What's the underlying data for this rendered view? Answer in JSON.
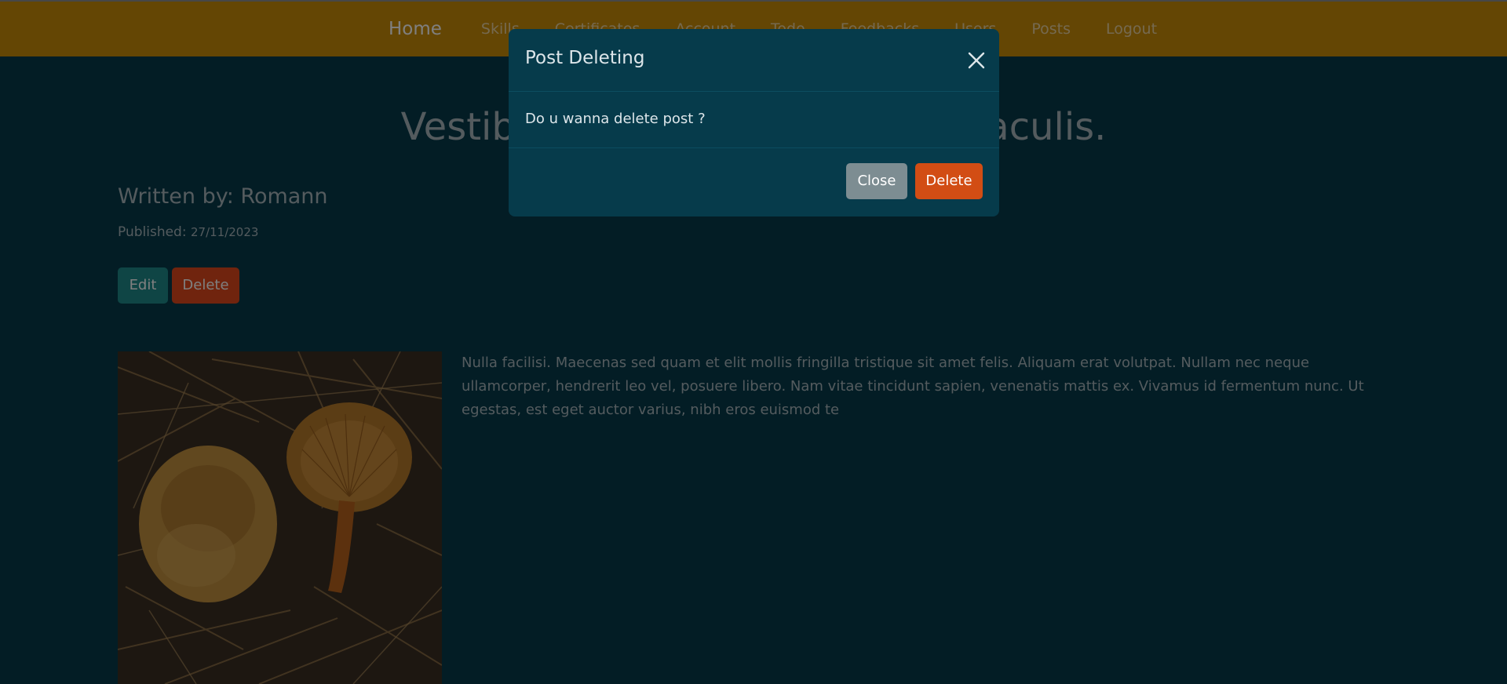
{
  "navbar": {
    "brand": "Home",
    "links": [
      "Skills",
      "Certificates",
      "Account",
      "Todo",
      "Feedbacks",
      "Users",
      "Posts",
      "Logout"
    ]
  },
  "post": {
    "title": "Vestibulum eget lectus ut orci iaculis.",
    "author": "Written by: Romann",
    "published_label": "Published:",
    "published_date": "27/11/2023",
    "edit_label": "Edit",
    "delete_label": "Delete",
    "body": "Nulla facilisi. Maecenas sed quam et elit mollis fringilla tristique sit amet felis. Aliquam erat volutpat. Nullam nec neque ullamcorper, hendrerit leo vel, posuere libero. Nam vitae tincidunt sapien, venenatis mattis ex. Vivamus id fermentum nunc. Ut egestas, est eget auctor varius, nibh eros euismod te"
  },
  "modal": {
    "title": "Post Deleting",
    "message": "Do u wanna delete post ?",
    "close_label": "Close",
    "delete_label": "Delete"
  },
  "colors": {
    "navbar": "#c98d09",
    "page_background": "#063b4b",
    "edit_button": "#1f8a8a",
    "delete_button": "#e0491d",
    "close_button": "#7d8d92"
  },
  "icons": {
    "modal_close": "close-icon"
  }
}
